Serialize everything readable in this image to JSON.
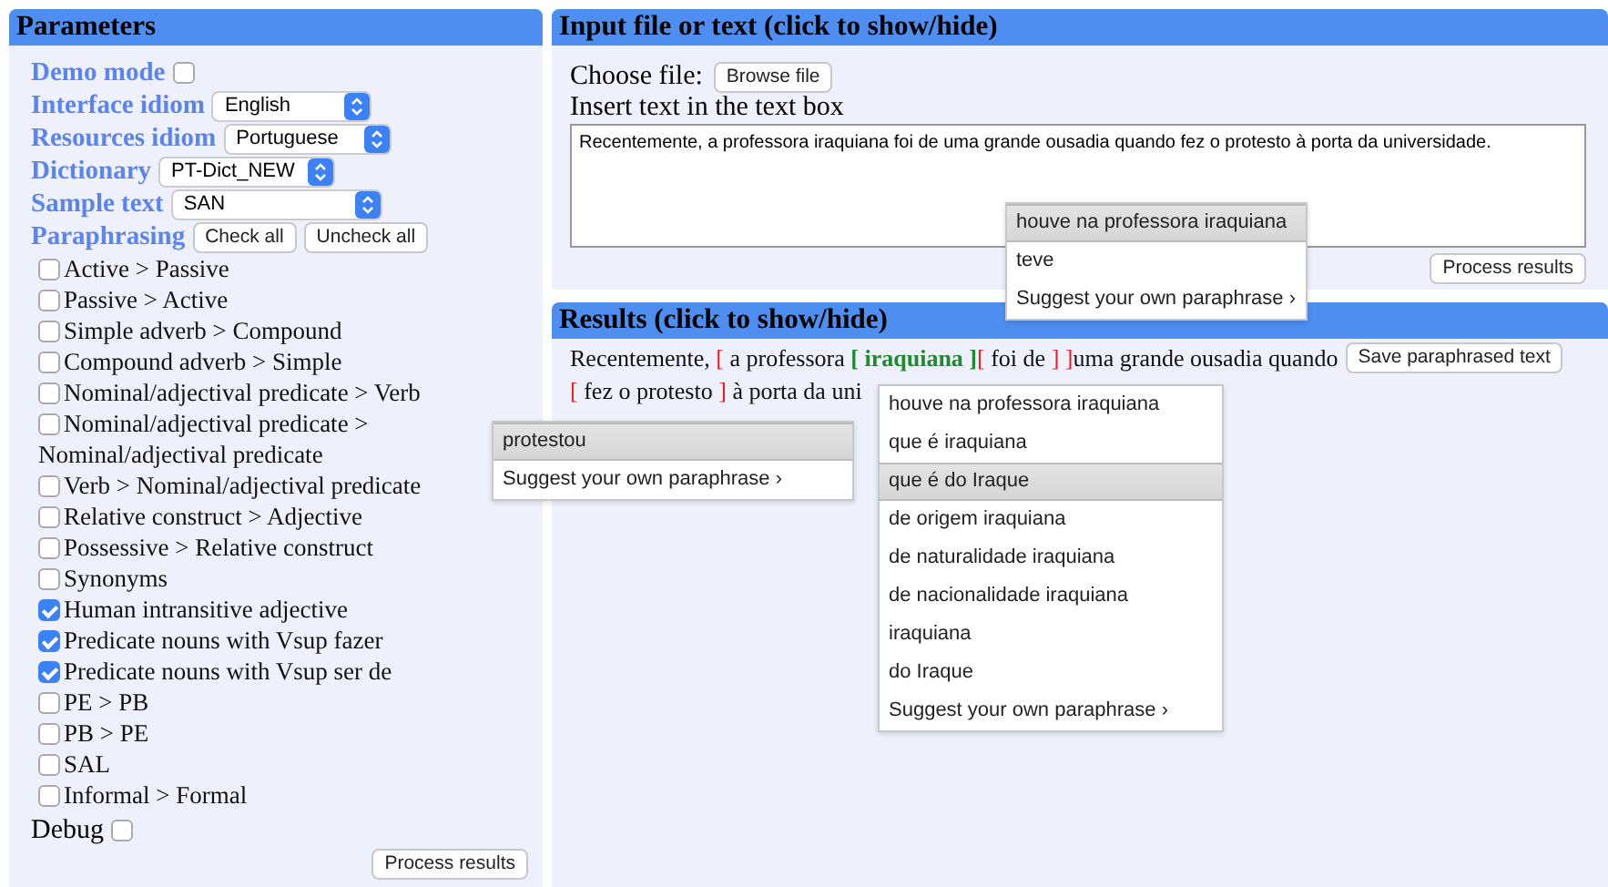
{
  "parameters": {
    "title": "Parameters",
    "demo_mode": {
      "label": "Demo mode",
      "checked": false
    },
    "selects": [
      {
        "label": "Interface idiom",
        "value": "English"
      },
      {
        "label": "Resources idiom",
        "value": "Portuguese"
      },
      {
        "label": "Dictionary",
        "value": "PT-Dict_NEW"
      },
      {
        "label": "Sample text",
        "value": "SAN"
      }
    ],
    "paraphrasing": {
      "label": "Paraphrasing",
      "buttons": [
        "Check all",
        "Uncheck all"
      ]
    },
    "options": [
      {
        "label": "Active > Passive",
        "checked": false
      },
      {
        "label": "Passive > Active",
        "checked": false
      },
      {
        "label": "Simple adverb > Compound",
        "checked": false
      },
      {
        "label": "Compound adverb > Simple",
        "checked": false
      },
      {
        "label": "Nominal/adjectival predicate > Verb",
        "checked": false
      },
      {
        "label": "Nominal/adjectival predicate > Nominal/adjectival predicate",
        "checked": false
      },
      {
        "label": "Verb > Nominal/adjectival predicate",
        "checked": false
      },
      {
        "label": "Relative construct > Adjective",
        "checked": false
      },
      {
        "label": "Possessive > Relative construct",
        "checked": false
      },
      {
        "label": "Synonyms",
        "checked": false
      },
      {
        "label": "Human intransitive adjective",
        "checked": true
      },
      {
        "label": "Predicate nouns with Vsup fazer",
        "checked": true
      },
      {
        "label": "Predicate nouns with Vsup ser de",
        "checked": true
      },
      {
        "label": "PE > PB",
        "checked": false
      },
      {
        "label": "PB > PE",
        "checked": false
      },
      {
        "label": "SAL",
        "checked": false
      },
      {
        "label": "Informal > Formal",
        "checked": false
      }
    ],
    "debug": {
      "label": "Debug",
      "checked": false
    },
    "process_button": "Process results"
  },
  "input": {
    "title": "Input file or text (click to show/hide)",
    "choose_file_label": "Choose file:",
    "browse_button": "Browse file",
    "text_label": "Insert text in the text box",
    "text": "Recentemente, a professora iraquiana foi de uma grande ousadia quando fez o protesto à porta da universidade.",
    "process_button": "Process results"
  },
  "results": {
    "title": "Results (click to show/hide)",
    "save_button": "Save paraphrased text",
    "lines": [
      [
        {
          "text": "Recentemente, ",
          "kind": "plain"
        },
        {
          "text": "[",
          "kind": "bracket"
        },
        {
          "text": " a professora ",
          "kind": "plain"
        },
        {
          "text": "[ iraquiana ]",
          "kind": "match"
        },
        {
          "text": "[",
          "kind": "bracket"
        },
        {
          "text": " foi de ",
          "kind": "plain"
        },
        {
          "text": "] ",
          "kind": "bracket"
        },
        {
          "text": "]",
          "kind": "bracket"
        },
        {
          "text": "uma grande ousadia quando",
          "kind": "plain"
        }
      ],
      [
        {
          "text": "[",
          "kind": "bracket"
        },
        {
          "text": " fez o protesto ",
          "kind": "plain"
        },
        {
          "text": "]",
          "kind": "bracket"
        },
        {
          "text": " à porta da uni",
          "kind": "plain"
        }
      ]
    ]
  },
  "menus": [
    {
      "items": [
        {
          "text": "houve na professora iraquiana",
          "selected": true
        },
        {
          "text": "teve",
          "selected": false
        },
        {
          "text": "Suggest your own paraphrase ›",
          "selected": false
        }
      ]
    },
    {
      "items": [
        {
          "text": "protestou",
          "selected": true
        },
        {
          "text": "Suggest your own paraphrase ›",
          "selected": false
        }
      ]
    },
    {
      "items": [
        {
          "text": "houve na professora iraquiana",
          "selected": false
        },
        {
          "text": "que é iraquiana",
          "selected": false
        },
        {
          "text": "que é do Iraque",
          "selected": true
        },
        {
          "text": "de origem iraquiana",
          "selected": false
        },
        {
          "text": "de naturalidade iraquiana",
          "selected": false
        },
        {
          "text": "de nacionalidade iraquiana",
          "selected": false
        },
        {
          "text": "iraquiana",
          "selected": false
        },
        {
          "text": "do Iraque",
          "selected": false
        },
        {
          "text": "Suggest your own paraphrase ›",
          "selected": false
        }
      ]
    }
  ]
}
